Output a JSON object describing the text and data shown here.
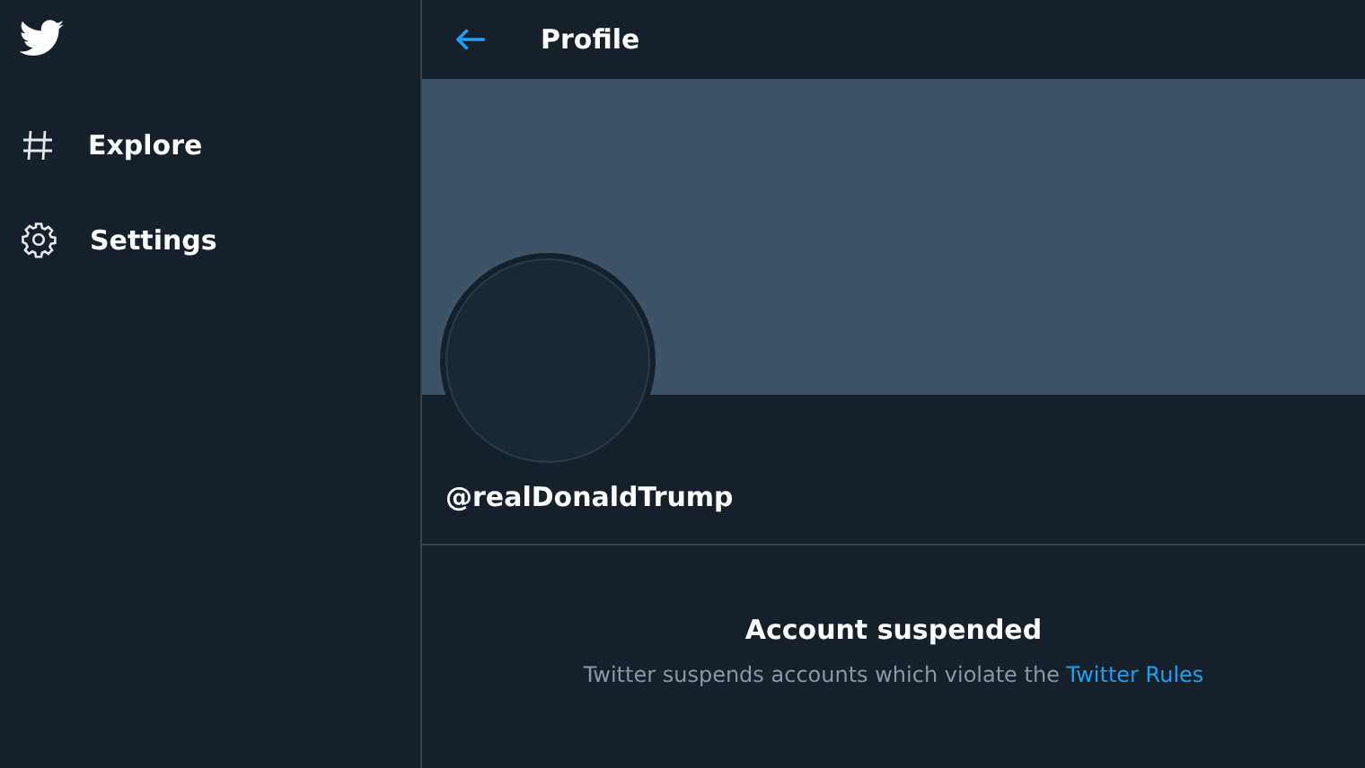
{
  "sidebar": {
    "items": [
      {
        "kind": "explore",
        "label": "Explore"
      },
      {
        "kind": "settings",
        "label": "Settings"
      }
    ]
  },
  "header": {
    "title": "Profile"
  },
  "profile": {
    "handle": "@realDonaldTrump"
  },
  "notice": {
    "title": "Account suspended",
    "text": "Twitter suspends accounts which violate the",
    "link": "Twitter Rules"
  }
}
